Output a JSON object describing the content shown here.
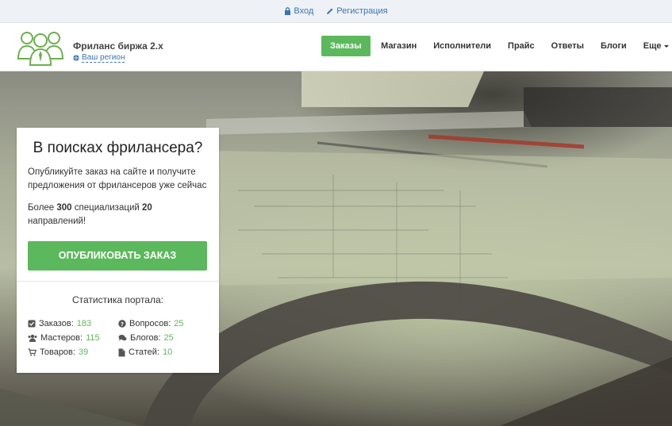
{
  "topbar": {
    "login": "Вход",
    "register": "Регистрация"
  },
  "header": {
    "site_title": "Фриланс биржа 2.x",
    "region": "Ваш регион"
  },
  "nav": {
    "items": [
      "Заказы",
      "Магазин",
      "Исполнители",
      "Прайс",
      "Ответы",
      "Блоги",
      "Еще"
    ],
    "active_index": 0
  },
  "card": {
    "title": "В поисках фрилансера?",
    "lead": "Опубликуйте заказ на сайте и получите предложения от фрилансеров уже сейчас",
    "more_prefix": "Более ",
    "more_specs": "300",
    "more_middle": " специализаций ",
    "more_dirs": "20",
    "more_suffix": " направлений!",
    "publish_button": "ОПУБЛИКОВАТЬ ЗАКАЗ",
    "stats_title": "Статистика портала:",
    "stats": {
      "orders": {
        "label": "Заказов:",
        "value": "183",
        "icon": "check-square-icon"
      },
      "masters": {
        "label": "Мастеров:",
        "value": "115",
        "icon": "users-icon"
      },
      "goods": {
        "label": "Товаров:",
        "value": "39",
        "icon": "cart-icon"
      },
      "questions": {
        "label": "Вопросов:",
        "value": "25",
        "icon": "question-circle-icon"
      },
      "blogs": {
        "label": "Блогов:",
        "value": "25",
        "icon": "comments-icon"
      },
      "articles": {
        "label": "Статей:",
        "value": "10",
        "icon": "file-icon"
      }
    }
  },
  "colors": {
    "accent": "#5cb85c",
    "link": "#3b74b8",
    "topbar_bg": "#eef2f6"
  }
}
